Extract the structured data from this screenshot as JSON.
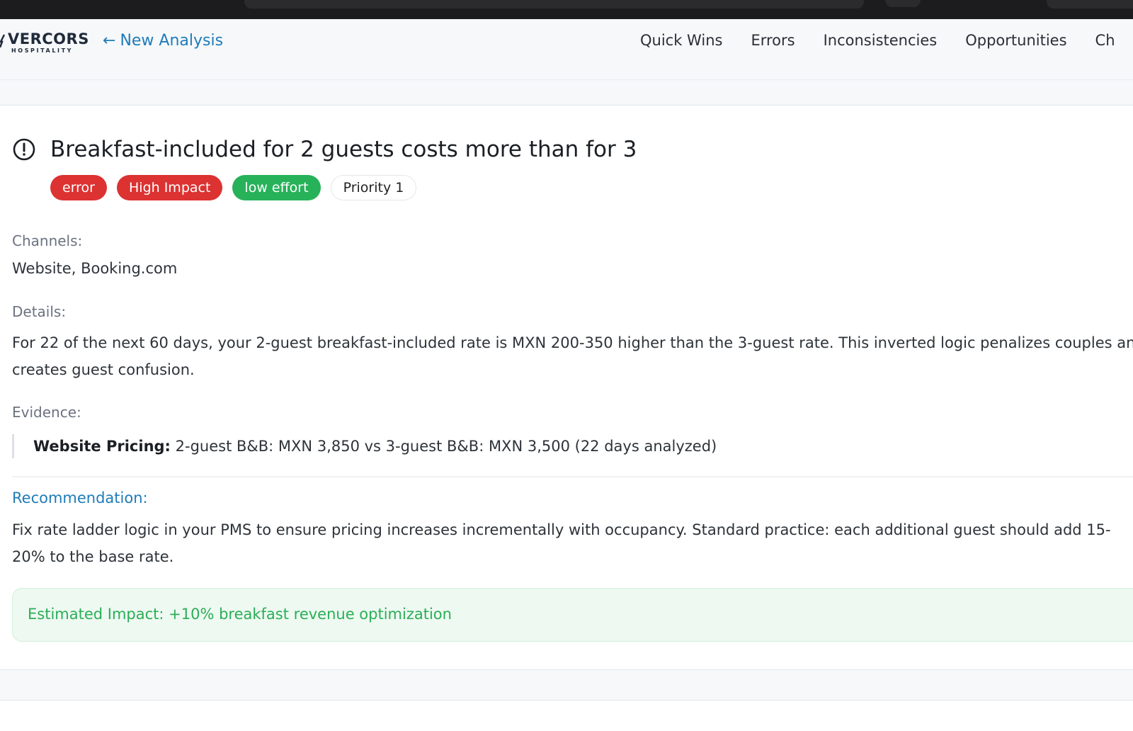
{
  "header": {
    "logo_name": "VERCORS",
    "logo_sub": "HOSPITALITY",
    "back_arrow": "←",
    "back_label": "New Analysis",
    "nav": [
      "Quick Wins",
      "Errors",
      "Inconsistencies",
      "Opportunities",
      "Ch"
    ]
  },
  "issue": {
    "icon": "alert-circle-icon",
    "title": "Breakfast-included for 2 guests costs more than for 3",
    "badges": {
      "type": "error",
      "impact": "High Impact",
      "effort": "low effort",
      "priority": "Priority 1"
    },
    "channels_label": "Channels:",
    "channels_value": "Website, Booking.com",
    "details_label": "Details:",
    "details_text": "For 22 of the next 60 days, your 2-guest breakfast-included rate is MXN 200-350 higher than the 3-guest rate. This inverted logic penalizes couples and creates guest confusion.",
    "evidence_label": "Evidence:",
    "evidence_source": "Website Pricing:",
    "evidence_text": "2-guest B&B: MXN 3,850 vs 3-guest B&B: MXN 3,500 (22 days analyzed)",
    "recommendation_label": "Recommendation:",
    "recommendation_text": "Fix rate ladder logic in your PMS to ensure pricing increases incrementally with occupancy. Standard practice: each additional guest should add 15-20% to the base rate.",
    "estimated_impact": "Estimated Impact: +10% breakfast revenue optimization"
  },
  "colors": {
    "error_red": "#dc3232",
    "effort_green": "#27b25a",
    "link_blue": "#1f7cb8",
    "impact_green": "#2bae57",
    "impact_bg": "#edf9f1"
  }
}
